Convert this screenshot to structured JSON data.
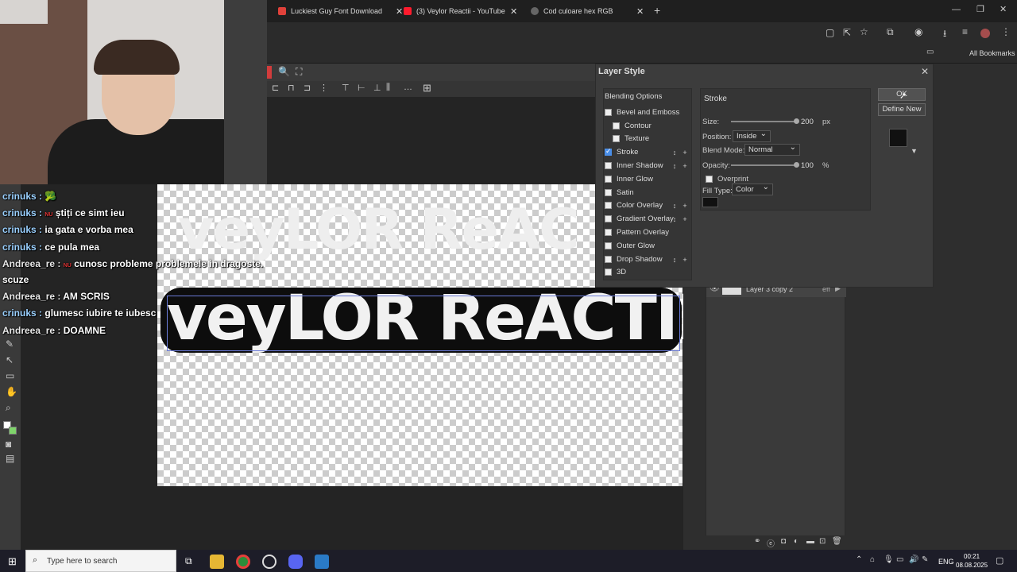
{
  "browser": {
    "tabs": [
      {
        "title": "Luckiest Guy Font Download",
        "color": "#e0413a"
      },
      {
        "title": "(3) Veylor Reactii - YouTube",
        "color": "#ff1b2d"
      },
      {
        "title": "Cod culoare hex RGB",
        "color": "#888888"
      }
    ],
    "all_bookmarks": "All Bookmarks"
  },
  "chat": [
    {
      "user": "crinuks :",
      "msg": "🥦"
    },
    {
      "user": "crinuks :",
      "badge": "NU",
      "msg": "știți ce simt ieu"
    },
    {
      "user": "crinuks :",
      "msg": "ia gata e vorba mea"
    },
    {
      "user": "crinuks :",
      "msg": "ce pula mea"
    },
    {
      "user": "Andreea_re :",
      "badge": "NU",
      "msg": "cunosc probleme problemele in dragoste."
    },
    {
      "user": "",
      "msg": "scuze"
    },
    {
      "user": "Andreea_re :",
      "msg": "AM SCRIS"
    },
    {
      "user": "crinuks :",
      "msg": "glumesc iubire te iubesc"
    },
    {
      "user": "Andreea_re :",
      "msg": "DOAMNE"
    }
  ],
  "canvas": {
    "ghost_text": "veyLOR ReAC",
    "main_text": "veyLOR ReACTII"
  },
  "dialog": {
    "title": "Layer Style",
    "section": "Stroke",
    "blending_options": "Blending Options",
    "options": [
      {
        "label": "Bevel and Emboss",
        "checked": false,
        "indent": false,
        "controls": false
      },
      {
        "label": "Contour",
        "checked": false,
        "indent": true,
        "controls": false
      },
      {
        "label": "Texture",
        "checked": false,
        "indent": true,
        "controls": false
      },
      {
        "label": "Stroke",
        "checked": true,
        "indent": false,
        "controls": true
      },
      {
        "label": "Inner Shadow",
        "checked": false,
        "indent": false,
        "controls": true
      },
      {
        "label": "Inner Glow",
        "checked": false,
        "indent": false,
        "controls": false
      },
      {
        "label": "Satin",
        "checked": false,
        "indent": false,
        "controls": false
      },
      {
        "label": "Color Overlay",
        "checked": false,
        "indent": false,
        "controls": true
      },
      {
        "label": "Gradient Overlay",
        "checked": false,
        "indent": false,
        "controls": true
      },
      {
        "label": "Pattern Overlay",
        "checked": false,
        "indent": false,
        "controls": false
      },
      {
        "label": "Outer Glow",
        "checked": false,
        "indent": false,
        "controls": false
      },
      {
        "label": "Drop Shadow",
        "checked": false,
        "indent": false,
        "controls": true
      },
      {
        "label": "3D",
        "checked": false,
        "indent": false,
        "controls": false
      }
    ],
    "size_label": "Size:",
    "size_value": "200",
    "size_unit": "px",
    "position_label": "Position:",
    "position_value": "Inside",
    "blend_label": "Blend Mode:",
    "blend_value": "Normal",
    "opacity_label": "Opacity:",
    "opacity_value": "100",
    "opacity_unit": "%",
    "overprint_label": "Overprint",
    "filltype_label": "Fill Type:",
    "filltype_value": "Color",
    "fill_color": "#111111",
    "ok_label": "OK",
    "define_new_label": "Define New"
  },
  "layers": {
    "layer_name": "Layer 3 copy 2",
    "eff": "eff"
  },
  "taskbar": {
    "search_placeholder": "Type here to search",
    "lang": "ENG",
    "time": "00:21",
    "date": "08.08.2025"
  }
}
